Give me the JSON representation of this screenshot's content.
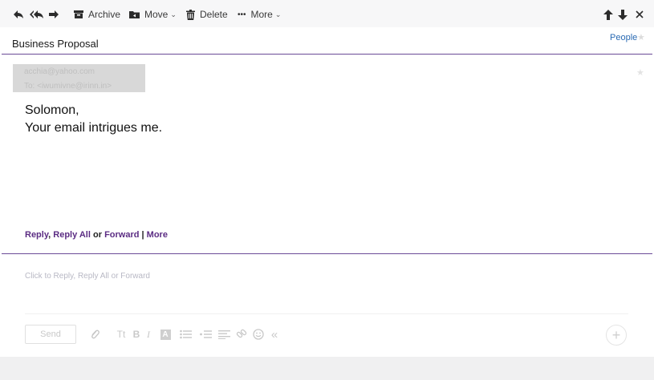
{
  "toolbar": {
    "archive_label": "Archive",
    "move_label": "Move",
    "delete_label": "Delete",
    "more_label": "More",
    "icons": [
      "reply-icon",
      "reply-all-icon",
      "forward-icon",
      "archive-icon",
      "move-icon",
      "delete-icon",
      "more-dots-icon",
      "arrow-up-icon",
      "arrow-down-icon",
      "close-icon"
    ]
  },
  "subject": "Business Proposal",
  "people_label": "People",
  "message": {
    "from": "acchia@yahoo.com",
    "to": "To: <iwumivne@irinn.in>",
    "greeting": "Solomon,",
    "body": "Your email intrigues me."
  },
  "reply_links": {
    "reply": "Reply",
    "comma": ",",
    "reply_all": "Reply All",
    "or": "or",
    "forward": "Forward",
    "sep": "|",
    "more": "More"
  },
  "compose": {
    "placeholder": "Click to Reply, Reply All or Forward",
    "send_label": "Send",
    "format_text_label": "Tt"
  },
  "colors": {
    "accent": "#6b4b97",
    "link": "#5b2c83",
    "people_link": "#2a6ab3"
  }
}
